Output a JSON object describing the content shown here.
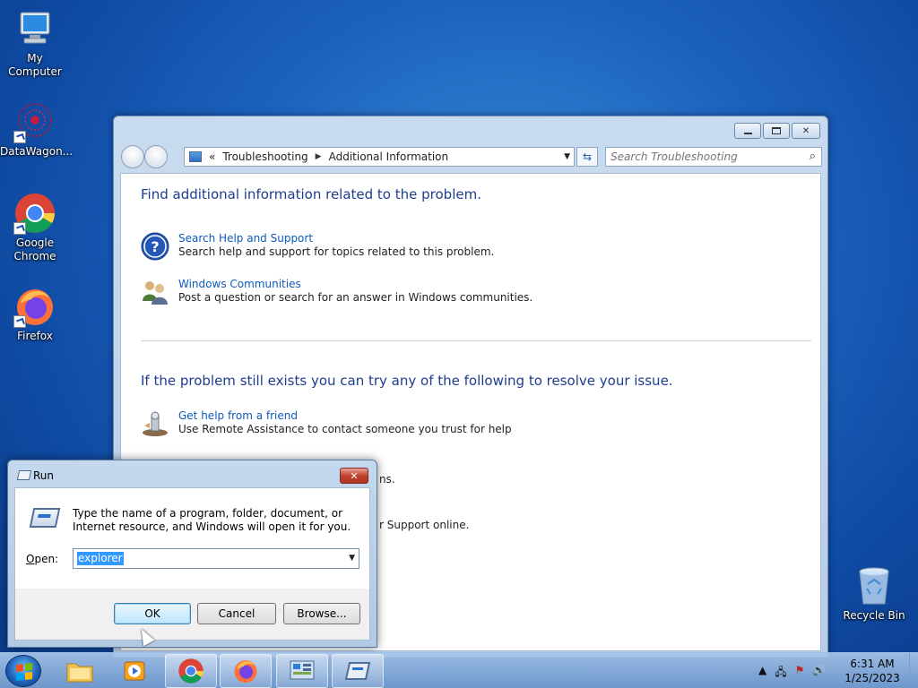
{
  "desktop": {
    "icons": [
      {
        "label": "My Computer"
      },
      {
        "label": "DataWagon..."
      },
      {
        "label": "Google Chrome"
      },
      {
        "label": "Firefox"
      },
      {
        "label": "Recycle Bin"
      }
    ]
  },
  "explorer": {
    "breadcrumb_prefix": "«",
    "breadcrumb": [
      "Troubleshooting",
      "Additional Information"
    ],
    "search_placeholder": "Search Troubleshooting",
    "heading1": "Find additional information related to the problem.",
    "options1": [
      {
        "link": "Search Help and Support",
        "desc": "Search help and support for topics related to this problem."
      },
      {
        "link": "Windows Communities",
        "desc": "Post a question or search for an answer in Windows communities."
      }
    ],
    "heading2": "If the problem still exists you can try any of the following to resolve your issue.",
    "options2": [
      {
        "link": "Get help from a friend",
        "desc": "Use Remote Assistance to contact someone you trust for help"
      }
    ],
    "partial_text1": "ns.",
    "partial_text2": "r Support online."
  },
  "run_dialog": {
    "title": "Run",
    "close_glyph": "✕",
    "description": "Type the name of a program, folder, document, or Internet resource, and Windows will open it for you.",
    "open_label_key": "O",
    "open_label_rest": "pen:",
    "value": "explorer",
    "ok_label": "OK",
    "cancel_label": "Cancel",
    "browse_label": "Browse..."
  },
  "taskbar": {
    "time": "6:31 AM",
    "date": "1/25/2023"
  }
}
